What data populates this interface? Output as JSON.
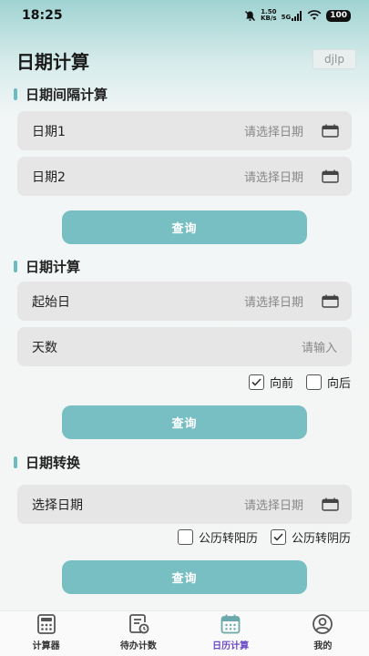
{
  "status": {
    "time": "18:25",
    "net_speed_value": "1.50",
    "net_speed_unit": "KB/s",
    "network_type": "5G",
    "battery": "100"
  },
  "header": {
    "title": "日期计算",
    "tag": "djlp"
  },
  "interval": {
    "title": "日期间隔计算",
    "date1_label": "日期1",
    "date1_placeholder": "请选择日期",
    "date2_label": "日期2",
    "date2_placeholder": "请选择日期",
    "button": "查询"
  },
  "calc": {
    "title": "日期计算",
    "start_label": "起始日",
    "start_placeholder": "请选择日期",
    "days_label": "天数",
    "days_placeholder": "请输入",
    "forward_label": "向前",
    "forward_checked": true,
    "backward_label": "向后",
    "backward_checked": false,
    "button": "查询"
  },
  "convert": {
    "title": "日期转换",
    "date_label": "选择日期",
    "date_placeholder": "请选择日期",
    "to_solar_label": "公历转阳历",
    "to_solar_checked": false,
    "to_lunar_label": "公历转阴历",
    "to_lunar_checked": true,
    "button": "查询"
  },
  "tabs": [
    {
      "label": "计算器",
      "icon": "calculator-icon",
      "active": false
    },
    {
      "label": "待办计数",
      "icon": "todo-icon",
      "active": false
    },
    {
      "label": "日历计算",
      "icon": "calendar-icon",
      "active": true
    },
    {
      "label": "我的",
      "icon": "user-icon",
      "active": false
    }
  ],
  "colors": {
    "accent": "#77bfc3",
    "active_tab": "#6b49c9",
    "section_bar": "#6bbcc0"
  }
}
